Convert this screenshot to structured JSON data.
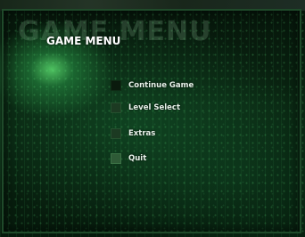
{
  "background_title": "GAME MENU",
  "menu_title": "GAME MENU",
  "menu_items": [
    {
      "label": "Continue Game",
      "icon": "square-box-icon"
    },
    {
      "label": "Level Select",
      "icon": "square-box-icon"
    },
    {
      "label": "Extras",
      "icon": "square-box-icon"
    },
    {
      "label": "Quit",
      "icon": "square-box-icon"
    }
  ],
  "colors": {
    "accent": "#3cd264",
    "text": "#ffffff",
    "background": "#061a0c"
  }
}
